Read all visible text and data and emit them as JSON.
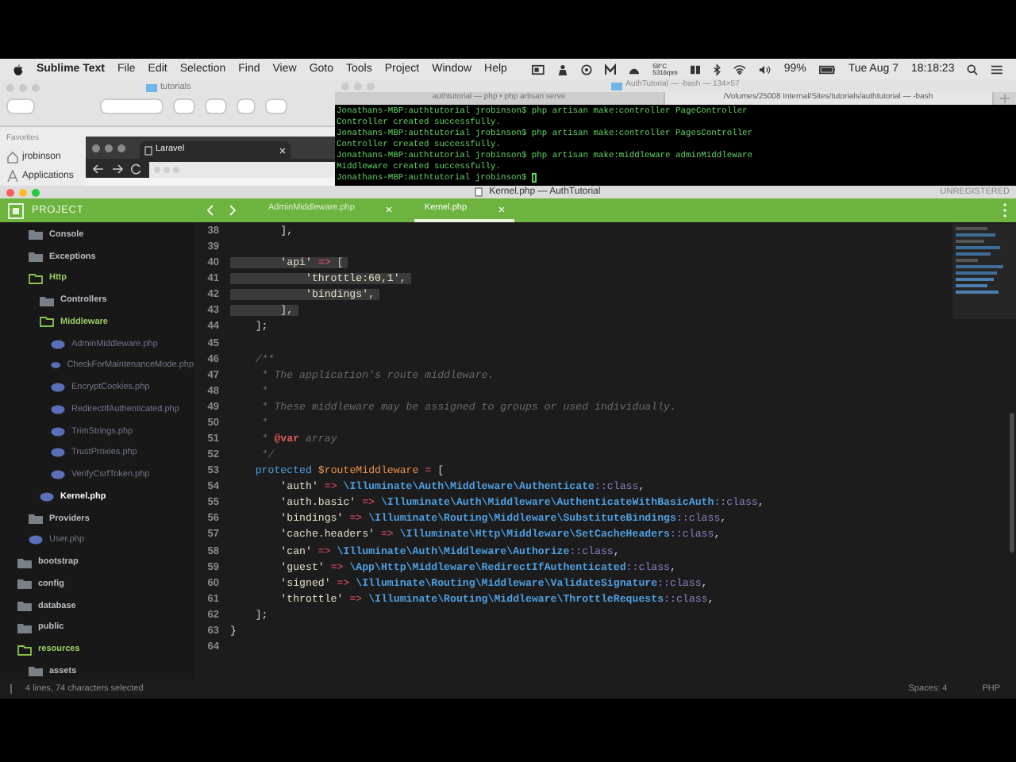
{
  "menu_bar": {
    "app": "Sublime Text",
    "items": [
      "File",
      "Edit",
      "Selection",
      "Find",
      "View",
      "Goto",
      "Tools",
      "Project",
      "Window",
      "Help"
    ],
    "temperature": "58°C",
    "fan": "5316rpm",
    "battery": "99%",
    "date": "Tue Aug 7",
    "time": "18:18:23"
  },
  "finder": {
    "title": "tutorials",
    "sidebar_heading": "Favorites",
    "items": [
      {
        "kind": "home",
        "label": "jrobinson"
      },
      {
        "kind": "apps",
        "label": "Applications"
      }
    ]
  },
  "browser": {
    "tab": "Laravel"
  },
  "terminal": {
    "title": "AuthTutorial — -bash — 134×57",
    "tabs": [
      {
        "label": "authtutorial — php • php artisan serve",
        "selected": false
      },
      {
        "label": "/Volumes/25008 Internal/Sites/tutorials/authtutorial — -bash",
        "selected": true
      }
    ],
    "lines": [
      "Jonathans-MBP:authtutorial jrobinson$ php artisan make:controller PageController",
      "Controller created successfully.",
      "Jonathans-MBP:authtutorial jrobinson$ php artisan make:controller PagesController",
      "Controller created successfully.",
      "Jonathans-MBP:authtutorial jrobinson$ php artisan make:middleware adminMiddleware",
      "Middleware created successfully.",
      "Jonathans-MBP:authtutorial jrobinson$ "
    ]
  },
  "editor_window": {
    "title": "Kernel.php — AuthTutorial",
    "badge": "UNREGISTERED"
  },
  "sidebar": {
    "title": "PROJECT",
    "tree": [
      {
        "children": [
          {
            "kind": "folder",
            "name": "Console",
            "expanded": false
          },
          {
            "kind": "folder",
            "name": "Exceptions",
            "expanded": false
          },
          {
            "kind": "folder",
            "name": "Http",
            "expanded": true,
            "children": [
              {
                "kind": "folder",
                "name": "Controllers",
                "expanded": false
              },
              {
                "kind": "folder",
                "name": "Middleware",
                "expanded": true,
                "children": [
                  {
                    "kind": "file",
                    "name": "AdminMiddleware.php",
                    "selected": false
                  },
                  {
                    "kind": "file",
                    "name": "CheckForMaintenanceMode.php",
                    "selected": false
                  },
                  {
                    "kind": "file",
                    "name": "EncryptCookies.php",
                    "selected": false
                  },
                  {
                    "kind": "file",
                    "name": "RedirectIfAuthenticated.php",
                    "selected": false
                  },
                  {
                    "kind": "file",
                    "name": "TrimStrings.php",
                    "selected": false
                  },
                  {
                    "kind": "file",
                    "name": "TrustProxies.php",
                    "selected": false
                  },
                  {
                    "kind": "file",
                    "name": "VerifyCsrfToken.php",
                    "selected": false
                  }
                ]
              },
              {
                "kind": "file",
                "name": "Kernel.php",
                "selected": true
              }
            ]
          },
          {
            "kind": "folder",
            "name": "Providers",
            "expanded": false
          },
          {
            "kind": "file",
            "name": "User.php",
            "selected": false
          }
        ]
      },
      {
        "kind": "folder",
        "name": "bootstrap",
        "expanded": false
      },
      {
        "kind": "folder",
        "name": "config",
        "expanded": false
      },
      {
        "kind": "folder",
        "name": "database",
        "expanded": false
      },
      {
        "kind": "folder",
        "name": "public",
        "expanded": false
      },
      {
        "kind": "folder",
        "name": "resources",
        "expanded": true,
        "children": [
          {
            "kind": "folder",
            "name": "assets",
            "expanded": false
          }
        ]
      }
    ]
  },
  "tabs": [
    {
      "label": "AdminMiddleware.php",
      "selected": false
    },
    {
      "label": "Kernel.php",
      "selected": true
    }
  ],
  "code_lines": [
    {
      "number": "38",
      "selected": false,
      "tokens": [
        {
          "kind": "punct",
          "text": "        ],"
        }
      ]
    },
    {
      "number": "39",
      "selected": false
    },
    {
      "number": "40",
      "selected": true,
      "tokens": [
        {
          "kind": "string",
          "text": "        'api'"
        },
        {
          "kind": "op",
          "text": " => "
        },
        {
          "kind": "punct",
          "text": "["
        }
      ]
    },
    {
      "number": "41",
      "selected": true,
      "tokens": [
        {
          "kind": "string",
          "text": "            'throttle:60,1'"
        },
        {
          "kind": "punct",
          "text": ","
        }
      ]
    },
    {
      "number": "42",
      "selected": true,
      "tokens": [
        {
          "kind": "string",
          "text": "            'bindings'"
        },
        {
          "kind": "punct",
          "text": ","
        }
      ]
    },
    {
      "number": "43",
      "selected": true,
      "tokens": [
        {
          "kind": "punct",
          "text": "        ],"
        }
      ]
    },
    {
      "number": "44",
      "selected": false,
      "tokens": [
        {
          "kind": "punct",
          "text": "    ];"
        }
      ]
    },
    {
      "number": "45",
      "selected": false
    },
    {
      "number": "46",
      "selected": false,
      "tokens": [
        {
          "kind": "comment",
          "text": "    /**"
        }
      ]
    },
    {
      "number": "47",
      "selected": false,
      "tokens": [
        {
          "kind": "comment",
          "text": "     * The application's route middleware."
        }
      ]
    },
    {
      "number": "48",
      "selected": false,
      "tokens": [
        {
          "kind": "comment",
          "text": "     *"
        }
      ]
    },
    {
      "number": "49",
      "selected": false,
      "tokens": [
        {
          "kind": "comment",
          "text": "     * These middleware may be assigned to groups or used individually."
        }
      ]
    },
    {
      "number": "50",
      "selected": false,
      "tokens": [
        {
          "kind": "comment",
          "text": "     *"
        }
      ]
    },
    {
      "number": "51",
      "selected": false,
      "tokens": [
        {
          "kind": "comment",
          "text": "     * "
        },
        {
          "kind": "annotation",
          "text": "@var"
        },
        {
          "kind": "comment",
          "text": " array"
        }
      ]
    },
    {
      "number": "52",
      "selected": false,
      "tokens": [
        {
          "kind": "comment",
          "text": "     */"
        }
      ]
    },
    {
      "number": "53",
      "selected": false,
      "tokens": [
        {
          "kind": "keyword",
          "text": "    protected"
        },
        {
          "kind": "variable",
          "text": " $routeMiddleware"
        },
        {
          "kind": "op",
          "text": " = "
        },
        {
          "kind": "punct",
          "text": "["
        }
      ]
    },
    {
      "number": "54",
      "selected": false,
      "tokens": [
        {
          "kind": "string",
          "text": "        'auth'"
        },
        {
          "kind": "op",
          "text": " => "
        },
        {
          "kind": "path",
          "text": "\\Illuminate\\Auth\\Middleware\\Authenticate"
        },
        {
          "kind": "classref",
          "text": "::class"
        },
        {
          "kind": "punct",
          "text": ","
        }
      ]
    },
    {
      "number": "55",
      "selected": false,
      "tokens": [
        {
          "kind": "string",
          "text": "        'auth.basic'"
        },
        {
          "kind": "op",
          "text": " => "
        },
        {
          "kind": "path",
          "text": "\\Illuminate\\Auth\\Middleware\\AuthenticateWithBasicAuth"
        },
        {
          "kind": "classref",
          "text": "::class"
        },
        {
          "kind": "punct",
          "text": ","
        }
      ]
    },
    {
      "number": "56",
      "selected": false,
      "tokens": [
        {
          "kind": "string",
          "text": "        'bindings'"
        },
        {
          "kind": "op",
          "text": " => "
        },
        {
          "kind": "path",
          "text": "\\Illuminate\\Routing\\Middleware\\SubstituteBindings"
        },
        {
          "kind": "classref",
          "text": "::class"
        },
        {
          "kind": "punct",
          "text": ","
        }
      ]
    },
    {
      "number": "57",
      "selected": false,
      "tokens": [
        {
          "kind": "string",
          "text": "        'cache.headers'"
        },
        {
          "kind": "op",
          "text": " => "
        },
        {
          "kind": "path",
          "text": "\\Illuminate\\Http\\Middleware\\SetCacheHeaders"
        },
        {
          "kind": "classref",
          "text": "::class"
        },
        {
          "kind": "punct",
          "text": ","
        }
      ]
    },
    {
      "number": "58",
      "selected": false,
      "tokens": [
        {
          "kind": "string",
          "text": "        'can'"
        },
        {
          "kind": "op",
          "text": " => "
        },
        {
          "kind": "path",
          "text": "\\Illuminate\\Auth\\Middleware\\Authorize"
        },
        {
          "kind": "classref",
          "text": "::class"
        },
        {
          "kind": "punct",
          "text": ","
        }
      ]
    },
    {
      "number": "59",
      "selected": false,
      "tokens": [
        {
          "kind": "string",
          "text": "        'guest'"
        },
        {
          "kind": "op",
          "text": " => "
        },
        {
          "kind": "path",
          "text": "\\App\\Http\\Middleware\\RedirectIfAuthenticated"
        },
        {
          "kind": "classref",
          "text": "::class"
        },
        {
          "kind": "punct",
          "text": ","
        }
      ]
    },
    {
      "number": "60",
      "selected": false,
      "tokens": [
        {
          "kind": "string",
          "text": "        'signed'"
        },
        {
          "kind": "op",
          "text": " => "
        },
        {
          "kind": "path",
          "text": "\\Illuminate\\Routing\\Middleware\\ValidateSignature"
        },
        {
          "kind": "classref",
          "text": "::class"
        },
        {
          "kind": "punct",
          "text": ","
        }
      ]
    },
    {
      "number": "61",
      "selected": false,
      "tokens": [
        {
          "kind": "string",
          "text": "        'throttle'"
        },
        {
          "kind": "op",
          "text": " => "
        },
        {
          "kind": "path",
          "text": "\\Illuminate\\Routing\\Middleware\\ThrottleRequests"
        },
        {
          "kind": "classref",
          "text": "::class"
        },
        {
          "kind": "punct",
          "text": ","
        }
      ]
    },
    {
      "number": "62",
      "selected": false,
      "tokens": [
        {
          "kind": "punct",
          "text": "    ];"
        }
      ]
    },
    {
      "number": "63",
      "selected": false,
      "tokens": [
        {
          "kind": "punct",
          "text": "}"
        }
      ]
    },
    {
      "number": "64",
      "selected": false
    }
  ],
  "status_bar": {
    "selection": "4 lines, 74 characters selected",
    "indent": "Spaces: 4",
    "syntax": "PHP"
  }
}
